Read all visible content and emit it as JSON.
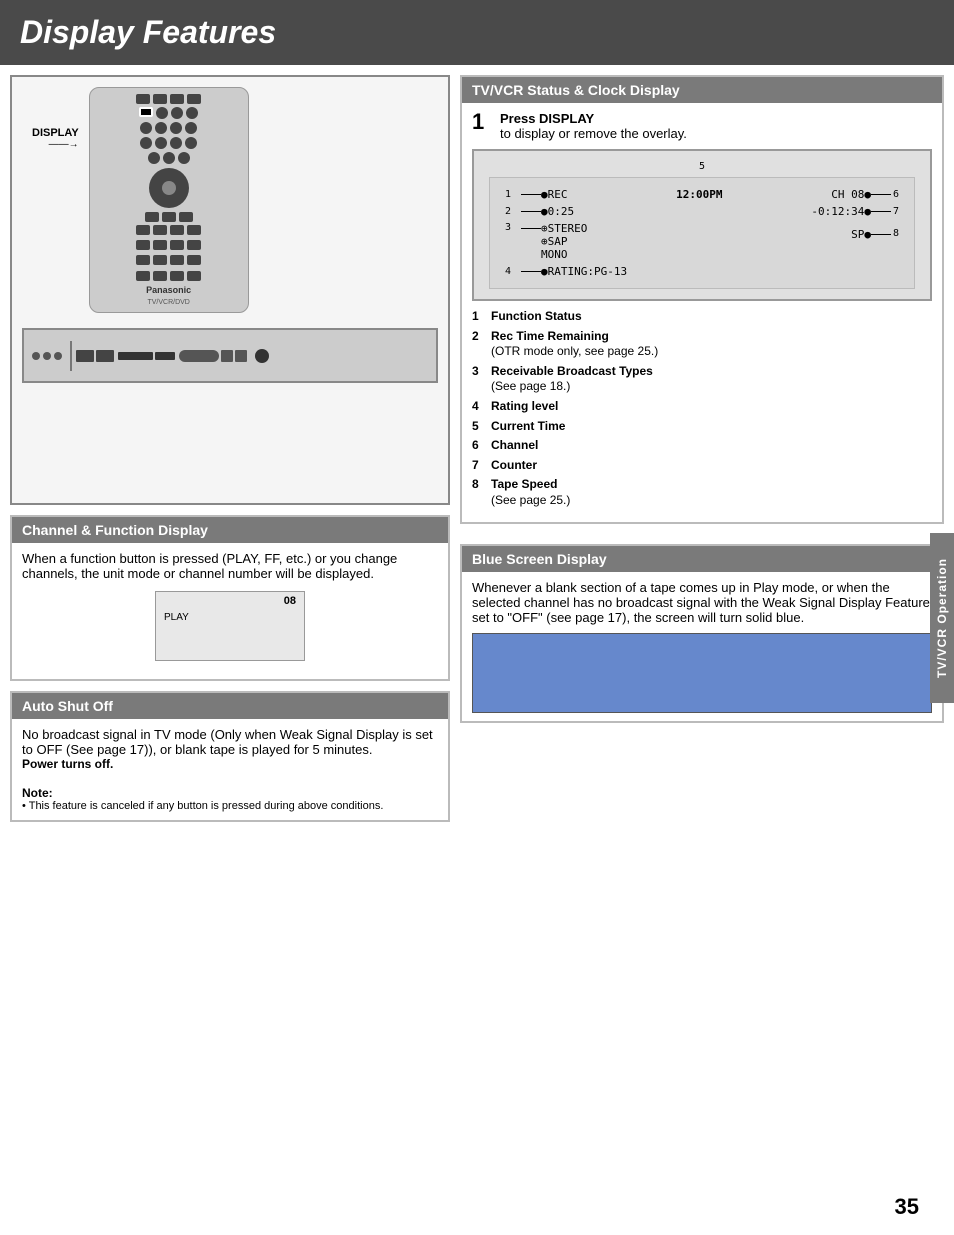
{
  "page": {
    "title": "Display Features",
    "page_number": "35",
    "side_tab": "TV/VCR Operation"
  },
  "remote": {
    "display_label": "DISPLAY",
    "brand": "Panasonic",
    "brand_sub": "TV/VCR/DVD"
  },
  "channel_section": {
    "header": "Channel & Function Display",
    "body": "When a function button is pressed (PLAY, FF, etc.) or you change channels, the unit mode or channel number will be displayed.",
    "channel_num": "08",
    "play_label": "PLAY"
  },
  "auto_shutoff": {
    "header": "Auto Shut Off",
    "body": "No broadcast signal in TV mode (Only when Weak Signal Display is set to OFF (See page 17)), or blank tape is played for 5 minutes.",
    "power_off": "Power turns off.",
    "note_label": "Note:",
    "note_text": "This feature is canceled if any button is pressed during above conditions."
  },
  "tvcvr_section": {
    "header": "TV/VCR Status & Clock Display",
    "step1_label": "1",
    "step1_title": "Press DISPLAY",
    "step1_body": "to display or remove the overlay.",
    "diagram": {
      "label5": "5",
      "row1_left": "1",
      "row1_dot1": "●REC",
      "row1_center": "12:00PM",
      "row1_right_label": "CH 08●",
      "row1_arrow": "6",
      "row2_left": "2",
      "row2_dot1": "●0:25",
      "row2_right": "-0:12:34●",
      "row2_arrow": "7",
      "row3_left": "3",
      "row3_stereo": "⊕STEREO",
      "row3_sap": "⊕SAP",
      "row3_mono": "MONO",
      "row3_sp": "SP●",
      "row3_arrow": "8",
      "row4_left": "4",
      "row4_rating": "●RATING:PG-13"
    },
    "items": [
      {
        "num": "1",
        "text": "Function Status"
      },
      {
        "num": "2",
        "text": "Rec Time Remaining\n(OTR mode only, see page 25.)"
      },
      {
        "num": "3",
        "text": "Receivable Broadcast Types\n(See page 18.)"
      },
      {
        "num": "4",
        "text": "Rating level"
      },
      {
        "num": "5",
        "text": "Current Time"
      },
      {
        "num": "6",
        "text": "Channel"
      },
      {
        "num": "7",
        "text": "Counter"
      },
      {
        "num": "8",
        "text": "Tape Speed\n(See page 25.)"
      }
    ]
  },
  "blue_section": {
    "header": "Blue Screen Display",
    "body": "Whenever a blank section of a tape comes up in Play mode, or when the selected channel has no broadcast signal with the Weak Signal Display Feature set to \"OFF\" (see page 17), the screen will turn solid blue."
  }
}
